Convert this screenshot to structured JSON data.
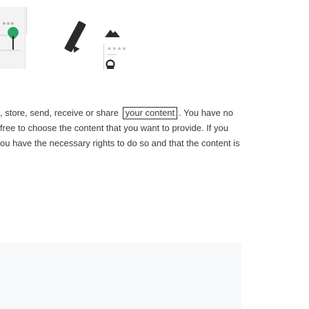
{
  "illustration": {
    "stars": "★★★★",
    "icons": [
      "pin-icon",
      "pen-icon",
      "mountain-icon",
      "avatar-icon"
    ]
  },
  "terms": {
    "line1_before": ", store, send, receive or share",
    "line1_highlight": "your content",
    "line1_after": ". You have no",
    "line2": "free to choose the content that you want to provide. If you",
    "line3": "ou have the necessary rights to do so and that the content is"
  },
  "colors": {
    "accent": "#2fa36b",
    "text": "#3a3a3a",
    "highlight_border": "#2b2b2b"
  }
}
